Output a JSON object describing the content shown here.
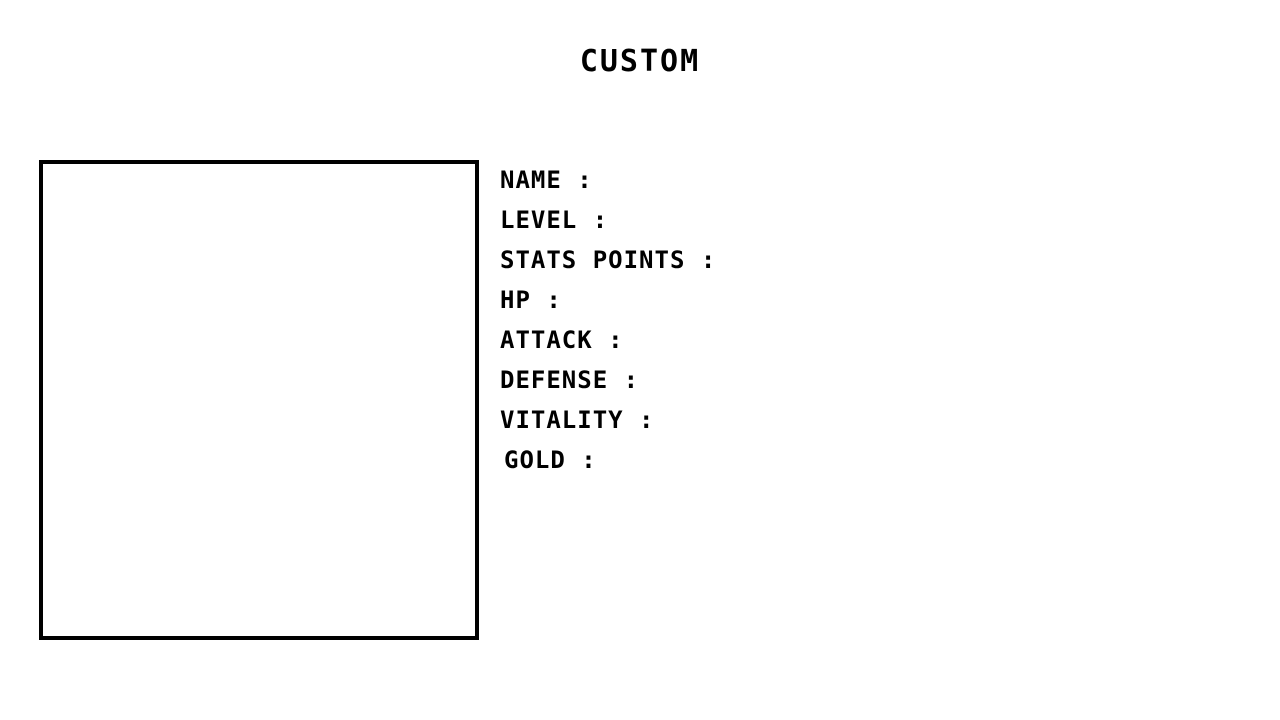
{
  "screen": {
    "title": "CUSTOM"
  },
  "character": {
    "stats": [
      {
        "label": "NAME :"
      },
      {
        "label": "LEVEL :"
      },
      {
        "label": "STATS POINTS :"
      },
      {
        "label": "HP :"
      },
      {
        "label": "ATTACK :"
      },
      {
        "label": "DEFENSE :"
      },
      {
        "label": "VITALITY :"
      },
      {
        "label": "GOLD :"
      }
    ]
  },
  "colors": {
    "background": "#ffffff",
    "ink": "#000000"
  }
}
